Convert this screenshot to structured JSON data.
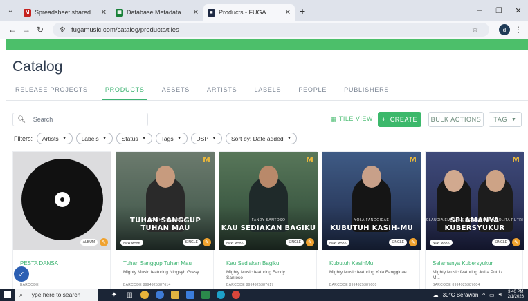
{
  "browser": {
    "tabs": [
      {
        "title": "Spreadsheet shared with you: \"",
        "fav_color": "#c5221f",
        "fav_glyph": "M",
        "active": false
      },
      {
        "title": "Database Metadata Master INI",
        "fav_color": "#188038",
        "fav_glyph": "▦",
        "active": false
      },
      {
        "title": "Products - FUGA",
        "fav_color": "#1f2a44",
        "fav_glyph": "■",
        "active": true
      }
    ],
    "url": "fugamusic.com/catalog/products/tiles",
    "profile_initial": "d"
  },
  "page": {
    "title": "Catalog",
    "nav_tabs": [
      "RELEASE PROJECTS",
      "PRODUCTS",
      "ASSETS",
      "ARTISTS",
      "LABELS",
      "PEOPLE",
      "PUBLISHERS"
    ],
    "active_tab": "PRODUCTS",
    "search_placeholder": "Search",
    "tile_view_label": "TILE VIEW",
    "create_label": "CREATE",
    "bulk_actions_label": "BULK ACTIONS",
    "tag_label": "TAG",
    "filters_label": "Filters:",
    "filters": [
      "Artists",
      "Labels",
      "Status",
      "Tags",
      "DSP",
      "Sort by: Date added"
    ]
  },
  "products": [
    {
      "title": "PESTA DANSA",
      "subtitle": "",
      "subtitle2": "",
      "barcode": "BARCODE",
      "type_badge": "ALBUM",
      "art": "vinyl"
    },
    {
      "title": "Tuhan Sanggup Tuhan Mau",
      "subtitle": "Mighty Music featuring Ningsyh Grasy...",
      "subtitle2": "",
      "barcode": "BARCODE  8994925387614",
      "type_badge": "SINGLE",
      "art": "cover",
      "cover_title": "TUHAN SANGGUP TUHAN MAU",
      "cover_artist": "NINGSYH GRASYELLA"
    },
    {
      "title": "Kau Sediakan Bagiku",
      "subtitle": "Mighty Music featuring Fandy",
      "subtitle2": "Santoso",
      "barcode": "BARCODE  8994925387617",
      "type_badge": "SINGLE",
      "art": "c2",
      "cover_title": "KAU SEDIAKAN BAGIKU",
      "cover_artist": "FANDY SANTOSO"
    },
    {
      "title": "Kubutuh KasihMu",
      "subtitle": "Mighty Music featuring Yola Fanggidae ...",
      "subtitle2": "",
      "barcode": "BARCODE  8994925387600",
      "type_badge": "SINGLE",
      "art": "c3",
      "cover_title": "KUBUTUH KASIH-MU",
      "cover_artist": "YOLA FANGGIDAE"
    },
    {
      "title": "Selamanya Kubersyukur",
      "subtitle": "Mighty Music featuring Jolita Putri /",
      "subtitle2": "M...",
      "barcode": "BARCODE  8994925387604",
      "type_badge": "SINGLE",
      "art": "c4",
      "cover_title": "SELAMANYA KUBERSYUKUR",
      "cover_artist": "CLAUDIA EMMANUELLE DUSILAW & JOLITA PUTRI"
    }
  ],
  "new_badge": "NEW MARK",
  "taskbar": {
    "search_placeholder": "Type here to search",
    "weather": "30°C  Berawan",
    "time": "3:40 PM",
    "date": "2/1/2026"
  },
  "colors": {
    "accent": "#3cb371",
    "header": "#4cbf6a",
    "edit": "#f0a22e"
  }
}
